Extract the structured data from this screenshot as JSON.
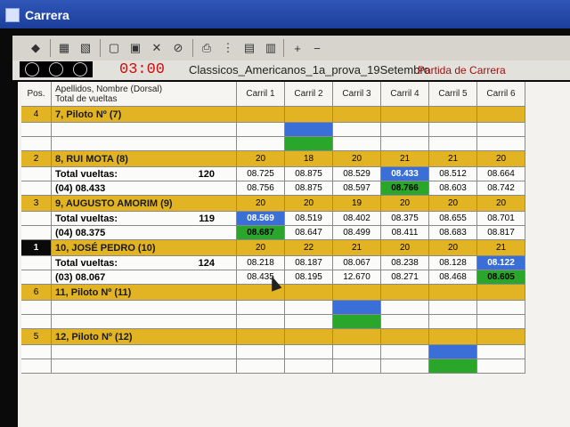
{
  "window": {
    "title": "Carrera"
  },
  "toolbar": {
    "icons": [
      "flag-icon",
      "grid1-icon",
      "grid2-icon",
      "page-icon",
      "page2-icon",
      "page-x-icon",
      "cancel-icon",
      "print-icon",
      "list-icon",
      "grid-icon",
      "table-icon",
      "plus-icon",
      "minus-icon"
    ]
  },
  "status": {
    "timer": "03:00",
    "race_name": "Classicos_Americanos_1a_prova_19Setembro",
    "overlay": "Partida de Carrera"
  },
  "table": {
    "headers": [
      "Pos.",
      "Apellidos, Nombre (Dorsal)",
      "Total de vueltas",
      "Carril 1",
      "Carril 2",
      "Carril 3",
      "Carril 4",
      "Carril 5",
      "Carril 6"
    ],
    "drivers": [
      {
        "pos": "4",
        "name": "7, Piloto Nº (7)",
        "laps": [
          "",
          "",
          "",
          "",
          "",
          ""
        ],
        "total_label": "",
        "total": "",
        "best": "",
        "rows": [
          [
            "",
            "",
            "",
            "",
            "",
            ""
          ],
          [
            "",
            "",
            "",
            "",
            "",
            ""
          ]
        ],
        "highlight": [
          [
            "",
            "blue",
            "",
            "",
            "",
            ""
          ],
          [
            "",
            "green",
            "",
            "",
            "",
            ""
          ]
        ]
      },
      {
        "pos": "2",
        "name": "8, RUI MOTA (8)",
        "laps": [
          "20",
          "18",
          "20",
          "21",
          "21",
          "20"
        ],
        "total_label": "Total vueltas:",
        "total": "120",
        "best": "(04) 08.433",
        "rows": [
          [
            "08.725",
            "08.875",
            "08.529",
            "08.433",
            "08.512",
            "08.664"
          ],
          [
            "08.756",
            "08.875",
            "08.597",
            "08.766",
            "08.603",
            "08.742"
          ]
        ],
        "highlight": [
          [
            "",
            "",
            "",
            "blue",
            "",
            ""
          ],
          [
            "",
            "",
            "",
            "green",
            "",
            ""
          ]
        ]
      },
      {
        "pos": "3",
        "name": "9, AUGUSTO AMORIM (9)",
        "laps": [
          "20",
          "20",
          "19",
          "20",
          "20",
          "20"
        ],
        "total_label": "Total vueltas:",
        "total": "119",
        "best": "(04) 08.375",
        "rows": [
          [
            "08.569",
            "08.519",
            "08.402",
            "08.375",
            "08.655",
            "08.701"
          ],
          [
            "08.687",
            "08.647",
            "08.499",
            "08.411",
            "08.683",
            "08.817"
          ]
        ],
        "highlight": [
          [
            "blue",
            "",
            "",
            "",
            "",
            ""
          ],
          [
            "green",
            "",
            "",
            "",
            "",
            ""
          ]
        ]
      },
      {
        "pos": "1",
        "name": "10, JOSÉ PEDRO (10)",
        "laps": [
          "20",
          "22",
          "21",
          "20",
          "20",
          "21"
        ],
        "total_label": "Total vueltas:",
        "total": "124",
        "best": "(03) 08.067",
        "rows": [
          [
            "08.218",
            "08.187",
            "08.067",
            "08.238",
            "08.128",
            "08.122"
          ],
          [
            "08.435",
            "08.195",
            "12.670",
            "08.271",
            "08.468",
            "08.605"
          ]
        ],
        "highlight": [
          [
            "",
            "",
            "",
            "",
            "",
            "blue"
          ],
          [
            "",
            "",
            "",
            "",
            "",
            "green"
          ]
        ]
      },
      {
        "pos": "6",
        "name": "11, Piloto Nº (11)",
        "laps": [
          "",
          "",
          "",
          "",
          "",
          ""
        ],
        "total_label": "",
        "total": "",
        "best": "",
        "rows": [
          [
            "",
            "",
            "",
            "",
            "",
            ""
          ],
          [
            "",
            "",
            "",
            "",
            "",
            ""
          ]
        ],
        "highlight": [
          [
            "",
            "",
            "blue",
            "",
            "",
            ""
          ],
          [
            "",
            "",
            "green",
            "",
            "",
            ""
          ]
        ]
      },
      {
        "pos": "5",
        "name": "12, Piloto Nº (12)",
        "laps": [
          "",
          "",
          "",
          "",
          "",
          ""
        ],
        "total_label": "",
        "total": "",
        "best": "",
        "rows": [
          [
            "",
            "",
            "",
            "",
            "",
            ""
          ],
          [
            "",
            "",
            "",
            "",
            "",
            ""
          ]
        ],
        "highlight": [
          [
            "",
            "",
            "",
            "",
            "blue",
            ""
          ],
          [
            "",
            "",
            "",
            "",
            "green",
            ""
          ]
        ]
      }
    ]
  }
}
